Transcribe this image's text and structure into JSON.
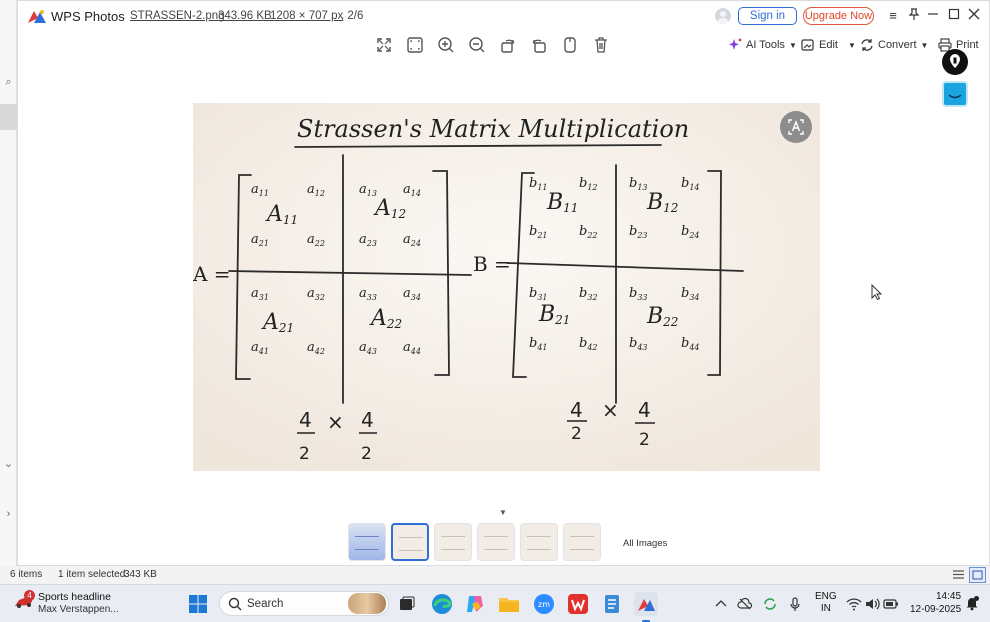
{
  "explorer": {
    "marks": [
      "⌕",
      "›",
      "⌄",
      "›"
    ]
  },
  "app": {
    "name": "WPS Photos",
    "file_name": "STRASSEN-2.png",
    "file_size": "343.96 KB",
    "file_dimensions": "1208 × 707 px",
    "file_index": ", 2/6",
    "sign_in": "Sign in",
    "upgrade": "Upgrade Now",
    "icons": [
      "menu-icon",
      "pin-icon",
      "minimize-icon",
      "maximize-icon",
      "close-icon"
    ]
  },
  "toolbar": {
    "ai_tools": "AI Tools",
    "edit": "Edit",
    "convert": "Convert",
    "print": "Print",
    "accent": "#2f6fd6"
  },
  "photo": {
    "title": "Strassen's Matrix Multiplication",
    "label_a": "A =",
    "label_b": "B =",
    "a_entries": [
      [
        "a11",
        "a12",
        "a13",
        "a14"
      ],
      [
        "a21",
        "a22",
        "a23",
        "a24"
      ],
      [
        "a31",
        "a32",
        "a33",
        "a34"
      ],
      [
        "a41",
        "a42",
        "a43",
        "a44"
      ]
    ],
    "a_blocks": [
      "A11",
      "A12",
      "A21",
      "A22"
    ],
    "b_entries": [
      [
        "b11",
        "b12",
        "b13",
        "b14"
      ],
      [
        "b21",
        "b22",
        "b23",
        "b24"
      ],
      [
        "b31",
        "b32",
        "b33",
        "b34"
      ],
      [
        "b41",
        "b42",
        "b43",
        "b44"
      ]
    ],
    "b_blocks": [
      "B11",
      "B12",
      "B21",
      "B22"
    ],
    "a_frac": {
      "num": "4",
      "op": "×",
      "den": "2"
    },
    "b_frac": {
      "num": "4",
      "op": "×",
      "den": "2"
    }
  },
  "thumbs": {
    "all_images": "All Images",
    "count": 6,
    "active_index": 1
  },
  "status": {
    "count": "6 items",
    "selected": "1 item selected",
    "size": "343 KB"
  },
  "taskbar": {
    "widget_badge": "4",
    "widget_title": "Sports headline",
    "widget_sub": "Max Verstappen...",
    "search": "Search",
    "lang_1": "ENG",
    "lang_2": "IN",
    "time": "14:45",
    "date": "12-09-2025"
  }
}
